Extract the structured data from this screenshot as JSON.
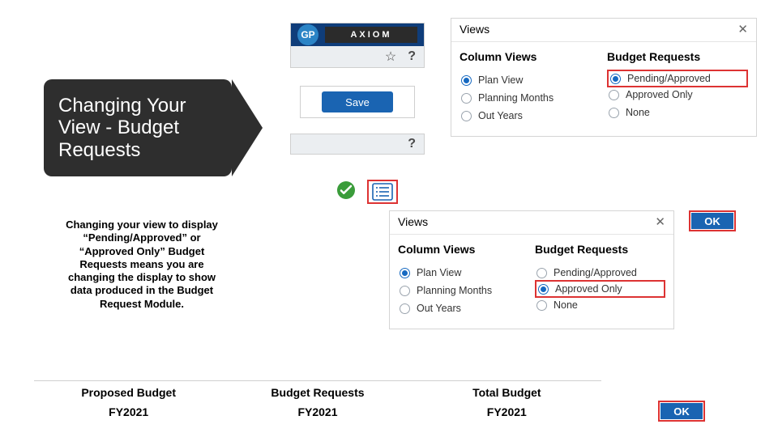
{
  "slide": {
    "title": "Changing Your View - Budget Requests",
    "description": "Changing your view to display “Pending/Approved” or “Approved Only” Budget Requests means you are changing the display to show data produced in the Budget Request Module."
  },
  "axiom": {
    "gp_badge": "GP",
    "logo_text": "AXIOM",
    "save_label": "Save"
  },
  "views_top": {
    "title": "Views",
    "col1_title": "Column Views",
    "col2_title": "Budget Requests",
    "col1": [
      {
        "label": "Plan View",
        "selected": true
      },
      {
        "label": "Planning Months",
        "selected": false
      },
      {
        "label": "Out Years",
        "selected": false
      }
    ],
    "col2": [
      {
        "label": "Pending/Approved",
        "selected": true,
        "hl": true
      },
      {
        "label": "Approved Only",
        "selected": false
      },
      {
        "label": "None",
        "selected": false
      }
    ]
  },
  "views_bottom": {
    "title": "Views",
    "col1_title": "Column Views",
    "col2_title": "Budget Requests",
    "col1": [
      {
        "label": "Plan View",
        "selected": true
      },
      {
        "label": "Planning Months",
        "selected": false
      },
      {
        "label": "Out Years",
        "selected": false
      }
    ],
    "col2": [
      {
        "label": "Pending/Approved",
        "selected": false
      },
      {
        "label": "Approved Only",
        "selected": true,
        "hl": true
      },
      {
        "label": "None",
        "selected": false
      }
    ]
  },
  "ok_label": "OK",
  "budget_columns": [
    {
      "header": "Proposed Budget",
      "year": "FY2021"
    },
    {
      "header": "Budget Requests",
      "year": "FY2021"
    },
    {
      "header": "Total Budget",
      "year": "FY2021"
    }
  ]
}
